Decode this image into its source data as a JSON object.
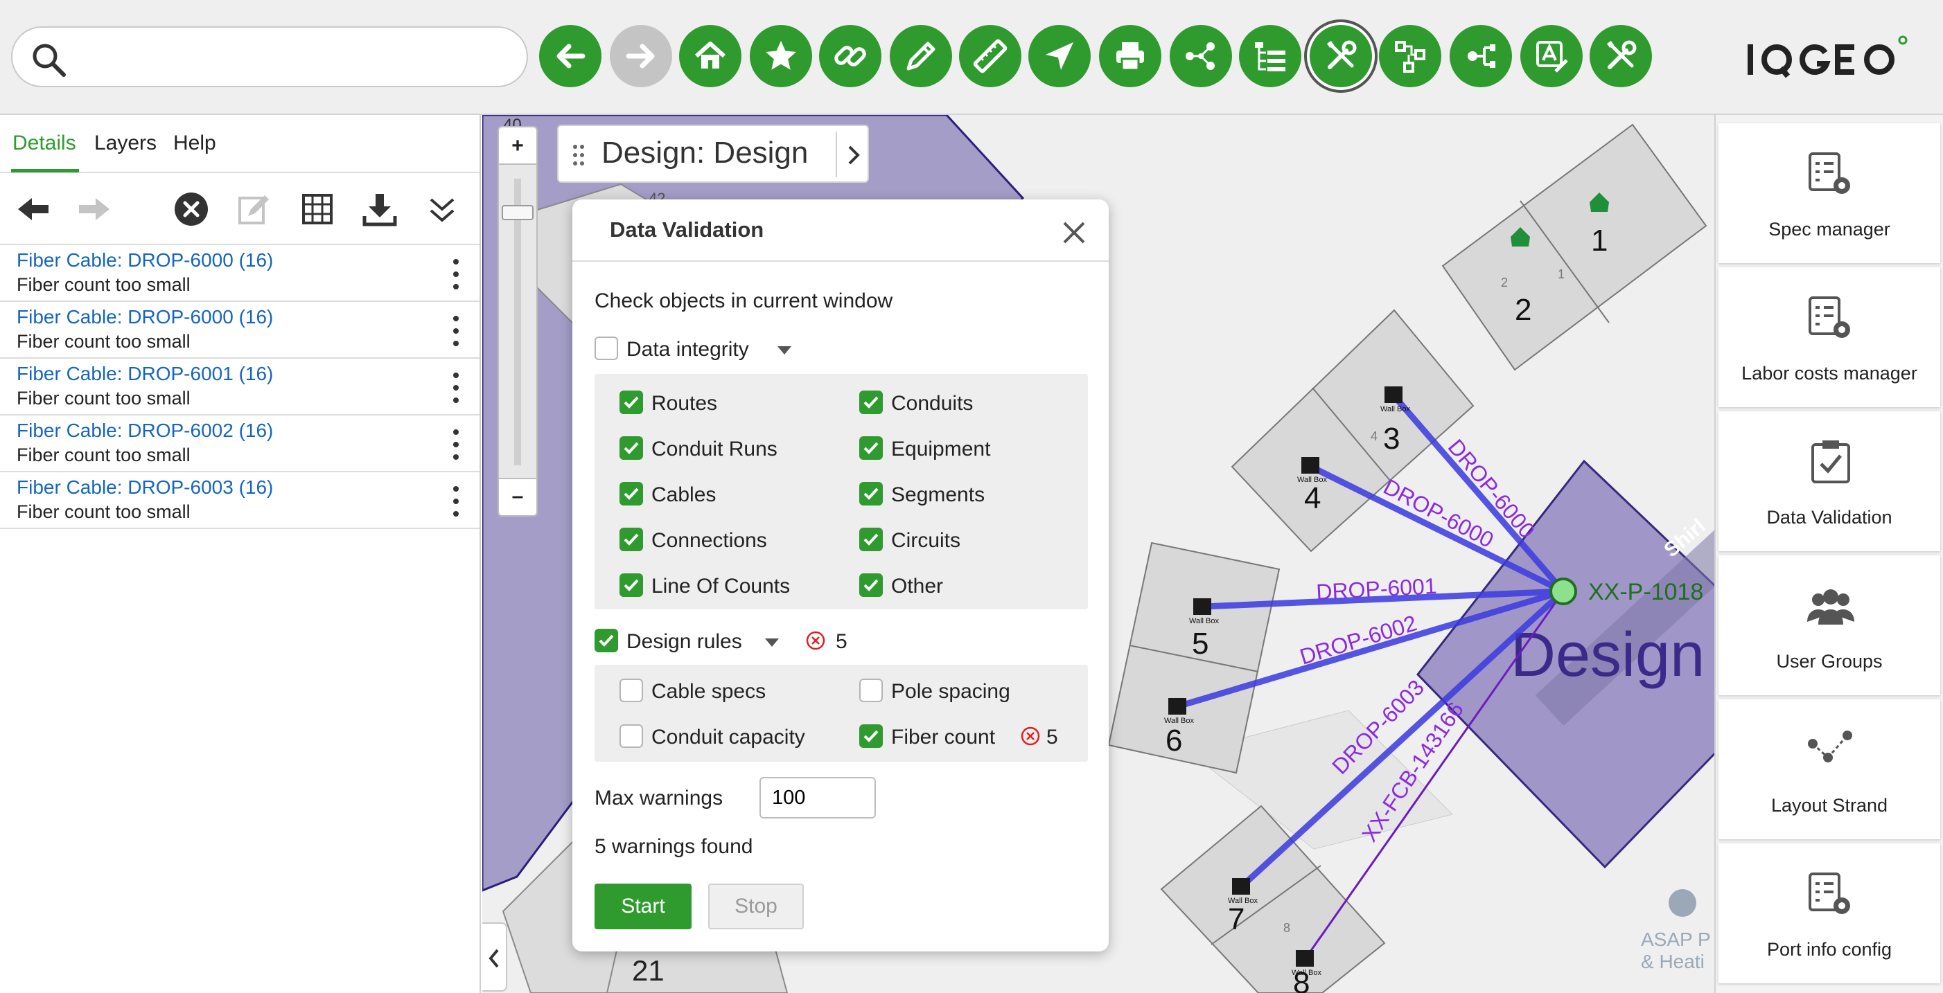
{
  "search": {
    "placeholder": "",
    "value": ""
  },
  "toolbar": {
    "buttons": [
      {
        "icon": "arrow-left-icon",
        "name": "back"
      },
      {
        "icon": "arrow-right-icon",
        "name": "forward"
      },
      {
        "icon": "home-icon",
        "name": "home"
      },
      {
        "icon": "star-icon",
        "name": "bookmarks"
      },
      {
        "icon": "link-icon",
        "name": "link"
      },
      {
        "icon": "pencil-icon",
        "name": "edit"
      },
      {
        "icon": "ruler-icon",
        "name": "measure"
      },
      {
        "icon": "navigate-icon",
        "name": "go-to"
      },
      {
        "icon": "printer-icon",
        "name": "print"
      },
      {
        "icon": "share-icon",
        "name": "share"
      },
      {
        "icon": "tree-icon",
        "name": "tree"
      },
      {
        "icon": "tools-icon",
        "name": "tools"
      },
      {
        "icon": "network-icon",
        "name": "network"
      },
      {
        "icon": "connectors-icon",
        "name": "connectors"
      },
      {
        "icon": "annotate-icon",
        "name": "annotate"
      },
      {
        "icon": "tools-icon",
        "name": "tools-2"
      }
    ],
    "logo_text": "IQGEO",
    "brand_color": "#2f9b2f"
  },
  "left_panel": {
    "tabs": [
      {
        "label": "Details",
        "active": true
      },
      {
        "label": "Layers",
        "active": false
      },
      {
        "label": "Help",
        "active": false
      }
    ],
    "results": [
      {
        "title": "Fiber Cable: DROP-6000 (16)",
        "subtitle": "Fiber count too small"
      },
      {
        "title": "Fiber Cable: DROP-6000 (16)",
        "subtitle": "Fiber count too small"
      },
      {
        "title": "Fiber Cable: DROP-6001 (16)",
        "subtitle": "Fiber count too small"
      },
      {
        "title": "Fiber Cable: DROP-6002 (16)",
        "subtitle": "Fiber count too small"
      },
      {
        "title": "Fiber Cable: DROP-6003 (16)",
        "subtitle": "Fiber count too small"
      }
    ]
  },
  "map": {
    "design_chip": "Design: Design",
    "zoom_in": "+",
    "zoom_out": "–",
    "scale_label": "40",
    "labels": {
      "n1": "1",
      "n2": "2",
      "n3": "3",
      "n4": "4",
      "n5": "5",
      "n6": "6",
      "n7": "7",
      "n8": "8",
      "n21": "21",
      "n42": "42",
      "s1": "1",
      "s2": "2",
      "s4": "4",
      "s8": "8",
      "wallbox": "Wall Box",
      "drop6000a": "DROP-6000",
      "drop6000b": "DROP-6000",
      "drop6001": "DROP-6001",
      "drop6002": "DROP-6002",
      "drop6003": "DROP-6003",
      "fcb": "XX-FCB-143166",
      "pole": "XX-P-1018",
      "design": "Design",
      "street": "Shirl",
      "poi1": "ASAP P",
      "poi2": "& Heati"
    }
  },
  "dialog": {
    "title": "Data Validation",
    "check_label": "Check objects in current window",
    "data_integrity": {
      "label": "Data integrity",
      "checked": false,
      "items": [
        {
          "label": "Routes",
          "checked": true
        },
        {
          "label": "Conduits",
          "checked": true
        },
        {
          "label": "Conduit Runs",
          "checked": true
        },
        {
          "label": "Equipment",
          "checked": true
        },
        {
          "label": "Cables",
          "checked": true
        },
        {
          "label": "Segments",
          "checked": true
        },
        {
          "label": "Connections",
          "checked": true
        },
        {
          "label": "Circuits",
          "checked": true
        },
        {
          "label": "Line Of Counts",
          "checked": true
        },
        {
          "label": "Other",
          "checked": true
        }
      ]
    },
    "design_rules": {
      "label": "Design rules",
      "checked": true,
      "error_count": "5",
      "items": [
        {
          "label": "Cable specs",
          "checked": false,
          "errors": ""
        },
        {
          "label": "Pole spacing",
          "checked": false,
          "errors": ""
        },
        {
          "label": "Conduit capacity",
          "checked": false,
          "errors": ""
        },
        {
          "label": "Fiber count",
          "checked": true,
          "errors": "5"
        }
      ]
    },
    "max_warnings_label": "Max warnings",
    "max_warnings_value": "100",
    "status": "5 warnings found",
    "start_label": "Start",
    "stop_label": "Stop"
  },
  "right_panel": {
    "cards": [
      {
        "label": "Spec manager",
        "icon": "spec-gear-icon"
      },
      {
        "label": "Labor costs manager",
        "icon": "labor-gear-icon"
      },
      {
        "label": "Data Validation",
        "icon": "validation-check-icon"
      },
      {
        "label": "User Groups",
        "icon": "user-groups-icon"
      },
      {
        "label": "Layout Strand",
        "icon": "layout-strand-icon"
      },
      {
        "label": "Port info config",
        "icon": "port-gear-icon"
      }
    ]
  }
}
